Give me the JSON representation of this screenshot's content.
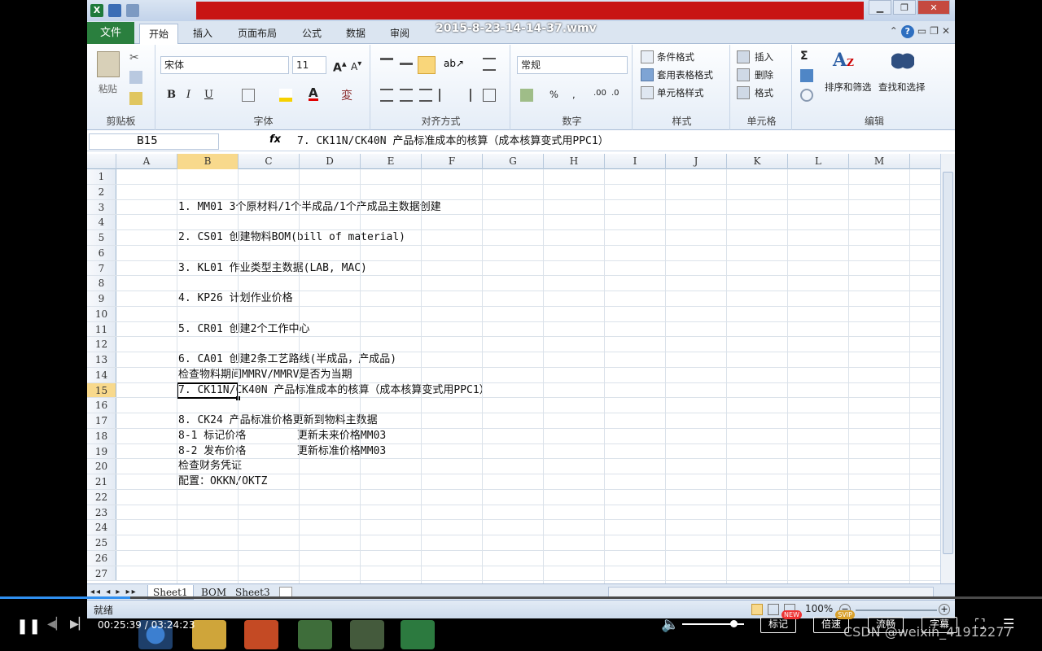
{
  "video": {
    "title": "2015-8-23-14-14-37.wmv",
    "time_current": "00:25:39",
    "time_separator": " / ",
    "time_total": "03:24:23",
    "progress_percent": 12.5,
    "buttons": {
      "mark": "标记",
      "mark_badge": "NEW",
      "speed": "倍速",
      "speed_badge": "SVIP",
      "stream": "流畅",
      "subtitle": "字幕"
    },
    "watermark": "CSDN @weixin_41912277"
  },
  "excel": {
    "tabs": {
      "file": "文件",
      "home": "开始",
      "insert": "插入",
      "layout": "页面布局",
      "formulas": "公式",
      "data": "数据",
      "review": "审阅"
    },
    "ribbon": {
      "clipboard": {
        "label": "剪贴板",
        "paste": "粘贴"
      },
      "font": {
        "label": "字体",
        "name": "宋体",
        "size": "11",
        "bold": "B",
        "italic": "I",
        "underline": "U"
      },
      "alignment": {
        "label": "对齐方式"
      },
      "number": {
        "label": "数字",
        "format": "常规"
      },
      "styles": {
        "label": "样式",
        "conditional": "条件格式",
        "table": "套用表格格式",
        "cell": "单元格样式"
      },
      "cells": {
        "label": "单元格",
        "insert": "插入",
        "delete": "删除",
        "format": "格式"
      },
      "editing": {
        "label": "编辑",
        "sort": "排序和筛选",
        "find": "查找和选择"
      }
    },
    "name_box": "B15",
    "fx": "fx",
    "formula": "7. CK11N/CK40N 产品标准成本的核算（成本核算变式用PPC1）",
    "columns": [
      "A",
      "B",
      "C",
      "D",
      "E",
      "F",
      "G",
      "H",
      "I",
      "J",
      "K",
      "L",
      "M"
    ],
    "selected_column": "B",
    "selected_row": "15",
    "rows": [
      {
        "n": "1",
        "text": ""
      },
      {
        "n": "2",
        "text": ""
      },
      {
        "n": "3",
        "text": "1. MM01 3个原材料/1个半成品/1个产成品主数据创建"
      },
      {
        "n": "4",
        "text": ""
      },
      {
        "n": "5",
        "text": "2. CS01 创建物料BOM(bill of material)"
      },
      {
        "n": "6",
        "text": ""
      },
      {
        "n": "7",
        "text": "3. KL01 作业类型主数据(LAB, MAC)"
      },
      {
        "n": "8",
        "text": ""
      },
      {
        "n": "9",
        "text": "4. KP26 计划作业价格"
      },
      {
        "n": "10",
        "text": ""
      },
      {
        "n": "11",
        "text": "5. CR01 创建2个工作中心"
      },
      {
        "n": "12",
        "text": ""
      },
      {
        "n": "13",
        "text": "6. CA01 创建2条工艺路线(半成品，产成品)"
      },
      {
        "n": "14",
        "text": "检查物料期间MMRV/MMRV是否为当期"
      },
      {
        "n": "15",
        "text": "7. CK11N/CK40N 产品标准成本的核算（成本核算变式用PPC1）"
      },
      {
        "n": "16",
        "text": ""
      },
      {
        "n": "17",
        "text": "8. CK24 产品标准价格更新到物料主数据"
      },
      {
        "n": "18",
        "text": "8-1 标记价格        更新未来价格MM03"
      },
      {
        "n": "19",
        "text": "8-2 发布价格        更新标准价格MM03"
      },
      {
        "n": "20",
        "text": "检查财务凭证"
      },
      {
        "n": "21",
        "text": "配置：OKKN/OKTZ"
      },
      {
        "n": "22",
        "text": ""
      },
      {
        "n": "23",
        "text": ""
      },
      {
        "n": "24",
        "text": ""
      },
      {
        "n": "25",
        "text": ""
      },
      {
        "n": "26",
        "text": ""
      },
      {
        "n": "27",
        "text": ""
      }
    ],
    "sheets": [
      "Sheet1",
      "BOM",
      "Sheet3"
    ],
    "status": {
      "ready": "就绪",
      "zoom": "100%"
    }
  }
}
